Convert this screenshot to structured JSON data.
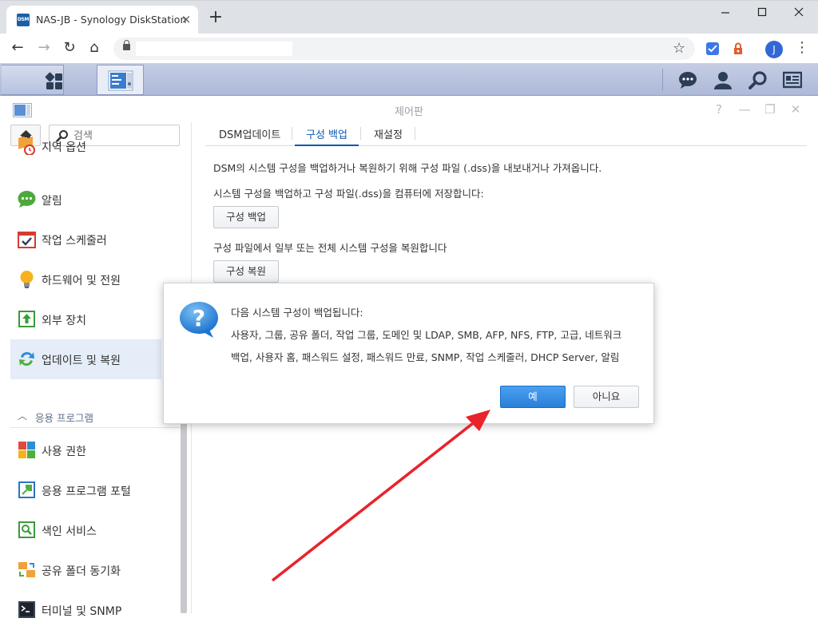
{
  "browser": {
    "tab_title": "NAS-JB - Synology DiskStation",
    "tab_favicon_text": "DSM",
    "new_tab": "+",
    "close_tab": "×",
    "minimize": "—",
    "maximize": "☐",
    "close_window": "✕",
    "profile_initial": "J",
    "back": "←",
    "forward": "→",
    "reload": "↻",
    "home": "⌂",
    "bookmark": "☆",
    "menu": "⋮"
  },
  "window": {
    "title": "제어판",
    "help": "?",
    "minimize": "—",
    "restore": "❐",
    "close": "✕"
  },
  "sidebar": {
    "search_placeholder": "검색",
    "items": [
      {
        "label": "지역 옵션",
        "icon": "regional-options-icon"
      },
      {
        "label": "알림",
        "icon": "notification-icon"
      },
      {
        "label": "작업 스케줄러",
        "icon": "task-scheduler-icon"
      },
      {
        "label": "하드웨어 및 전원",
        "icon": "hardware-power-icon"
      },
      {
        "label": "외부 장치",
        "icon": "external-devices-icon"
      },
      {
        "label": "업데이트 및 복원",
        "icon": "update-restore-icon",
        "active": true
      }
    ],
    "section_label": "응용 프로그램",
    "app_items": [
      {
        "label": "사용 권한",
        "icon": "privileges-icon"
      },
      {
        "label": "응용 프로그램 포털",
        "icon": "application-portal-icon"
      },
      {
        "label": "색인 서비스",
        "icon": "indexing-service-icon"
      },
      {
        "label": "공유 폴더 동기화",
        "icon": "shared-folder-sync-icon"
      },
      {
        "label": "터미널 및 SNMP",
        "icon": "terminal-snmp-icon"
      }
    ]
  },
  "tabs": [
    {
      "label": "DSM업데이트"
    },
    {
      "label": "구성 백업",
      "active": true
    },
    {
      "label": "재설정"
    }
  ],
  "content": {
    "intro": "DSM의 시스템 구성을 백업하거나 복원하기 위해 구성 파일 (.dss)을 내보내거나 가져옵니다.",
    "backup_desc": "시스템 구성을 백업하고 구성 파일(.dss)을 컴퓨터에 저장합니다:",
    "backup_button": "구성 백업",
    "restore_desc": "구성 파일에서 일부 또는 전체 시스템 구성을 복원합니다",
    "restore_button": "구성 복원"
  },
  "dialog": {
    "line1": "다음 시스템 구성이 백업됩니다:",
    "line2": "사용자, 그룹, 공유 폴더, 작업 그룹, 도메인 및 LDAP, SMB, AFP, NFS, FTP, 고급, 네트워크",
    "line3": "백업, 사용자 홈, 패스워드 설정, 패스워드 만료, SNMP, 작업 스케줄러, DHCP Server, 알림",
    "yes": "예",
    "no": "아니요",
    "icon": "question-icon"
  },
  "annotation": {
    "arrow_color": "#e8232b",
    "points_to": "yes-button"
  }
}
